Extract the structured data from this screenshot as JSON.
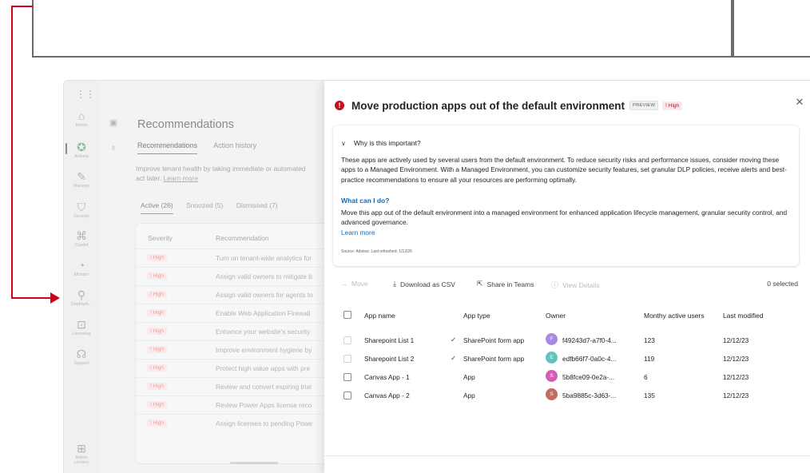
{
  "left_rail": {
    "items": [
      {
        "name": "home",
        "label": "Home",
        "icon": "home-icon",
        "glyph": "⌂"
      },
      {
        "name": "actions",
        "label": "Actions",
        "icon": "actions-icon",
        "glyph": "✪"
      },
      {
        "name": "manage",
        "label": "Manage",
        "icon": "manage-icon",
        "glyph": "✎"
      },
      {
        "name": "security",
        "label": "Security",
        "icon": "shield-icon",
        "glyph": "⛉"
      },
      {
        "name": "copilot",
        "label": "Copilot",
        "icon": "copilot-icon",
        "glyph": "⌘"
      },
      {
        "name": "monitor",
        "label": "Monitor",
        "icon": "monitor-icon",
        "glyph": "◔"
      },
      {
        "name": "deployment",
        "label": "Deploym...",
        "icon": "deployment-icon",
        "glyph": "⚲"
      },
      {
        "name": "licensing",
        "label": "Licensing",
        "icon": "licensing-icon",
        "glyph": "⊡"
      },
      {
        "name": "support",
        "label": "Support",
        "icon": "support-icon",
        "glyph": "☊"
      }
    ],
    "admin_centers": {
      "label_1": "Admin",
      "label_2": "centers",
      "icon": "admin-centers-icon",
      "glyph": "⊞"
    }
  },
  "background_page": {
    "title": "Recommendations",
    "tabs": [
      "Recommendations",
      "Action history"
    ],
    "description": "Improve tenant health by taking immediate or automated",
    "description_2": "act later.",
    "learn_more": "Learn more",
    "filter_tabs": [
      "Active (26)",
      "Snoozed (5)",
      "Dismissed (7)"
    ],
    "columns": {
      "severity": "Severity",
      "recommendation": "Recommendation"
    },
    "rows": [
      {
        "severity": "! High",
        "text": "Turn on tenant-wide analytics for"
      },
      {
        "severity": "! High",
        "text": "Assign valid owners to mitigate b"
      },
      {
        "severity": "! High",
        "text": "Assign valid owners for agents to"
      },
      {
        "severity": "! High",
        "text": "Enable Web Application Firewall"
      },
      {
        "severity": "! High",
        "text": "Enhance your website's security"
      },
      {
        "severity": "! High",
        "text": "Improve environment hygiene by"
      },
      {
        "severity": "! High",
        "text": "Protect high value apps with pre"
      },
      {
        "severity": "! High",
        "text": "Review and convert expiring trial"
      },
      {
        "severity": "! High",
        "text": "Review Power Apps license reco"
      },
      {
        "severity": "! High",
        "text": "Assign licenses to pending Powe"
      }
    ]
  },
  "panel": {
    "title": "Move production apps out of the default environment",
    "badge_preview": "PREVIEW",
    "badge_high": "! High",
    "close": "✕",
    "why_heading": "Why is this important?",
    "why_text": "These apps are actively used by several users from the default environment. To reduce security risks and performance issues, consider moving these apps to a Managed Environment. With a Managed Environment, you can customize security features, set granular DLP policies, receive alerts and best-practice recommendations to ensure all your resources are performing optimally.",
    "what_heading": "What can I do?",
    "what_text": "Move this app out of the default environment into a managed environment for enhanced application lifecycle management, granular security control, and advanced governance.",
    "learn_more": "Learn more",
    "source": "Source: Advisor. Last refreshed: 1/12/26",
    "toolbar": {
      "move": "Move",
      "download": "Download as CSV",
      "share": "Share in Teams",
      "view_details": "View Details",
      "selected": "0 selected"
    },
    "table": {
      "headers": {
        "name": "App name",
        "type": "App type",
        "owner": "Owner",
        "mau": "Monthy active users",
        "modified": "Last modified"
      },
      "rows": [
        {
          "name": "Sharepoint List 1",
          "type": "SharePoint form app",
          "initial": "F",
          "avatar_color": "#a78bdf",
          "owner": "f49243d7-a7f0-4...",
          "mau": "123",
          "modified": "12/12/23",
          "checked_type": "✓"
        },
        {
          "name": "Sharepoint List 2",
          "type": "SharePoint form app",
          "initial": "E",
          "avatar_color": "#5fc4be",
          "owner": "edfb66f7-0a0c-4...",
          "mau": "119",
          "modified": "12/12/23",
          "checked_type": "✓"
        },
        {
          "name": "Canvas App - 1",
          "type": "App",
          "initial": "S",
          "avatar_color": "#d25fb3",
          "owner": "5b8fce09-0e2a-...",
          "mau": "6",
          "modified": "12/12/23",
          "checked_type": ""
        },
        {
          "name": "Canvas App - 2",
          "type": "App",
          "initial": "S",
          "avatar_color": "#c36b5e",
          "owner": "5ba9885c-3d63-...",
          "mau": "135",
          "modified": "12/12/23",
          "checked_type": ""
        }
      ]
    }
  },
  "colors": {
    "accent": "#0f6cbd",
    "danger": "#c50f1f",
    "annotation": "#d0021b"
  }
}
